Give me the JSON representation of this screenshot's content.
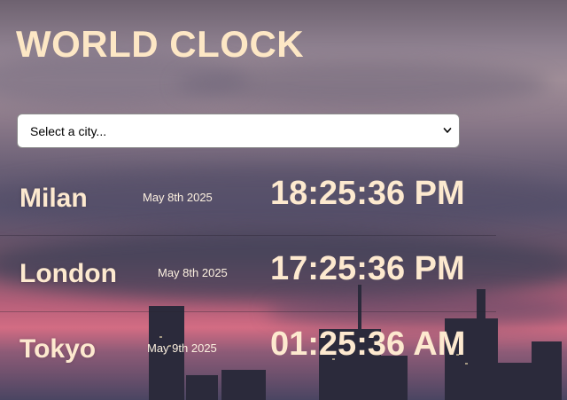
{
  "title": "WORLD CLOCK",
  "city_select": {
    "value": "Select a city..."
  },
  "clocks": [
    {
      "city": "Milan",
      "date": "May 8th 2025",
      "time": "18:25:36 PM"
    },
    {
      "city": "London",
      "date": "May 8th 2025",
      "time": "17:25:36 PM"
    },
    {
      "city": "Tokyo",
      "date": "May 9th 2025",
      "time": "01:25:36 AM"
    }
  ],
  "colors": {
    "title": "#fde7c5",
    "text": "#fde9cf",
    "select_bg": "#ffffff"
  },
  "icons": {
    "select_chevron": "chevron-down-icon"
  }
}
